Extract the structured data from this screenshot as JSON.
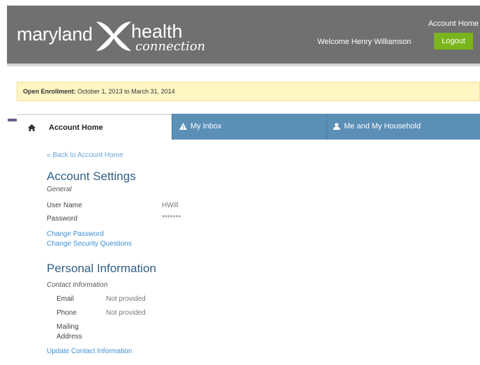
{
  "header": {
    "logo_maryland": "maryland",
    "logo_health": "health",
    "logo_connection": "connection",
    "account_home_link": "Account Home",
    "welcome_text": "Welcome Henry Williamson",
    "logout_label": "Logout",
    "header_bg": "#707070",
    "logout_color": "#7ab51d"
  },
  "notice": {
    "label": "Open Enrollment:",
    "text": "October 1, 2013 to March 31, 2014"
  },
  "tabs": [
    {
      "label": "Account Home",
      "icon": "home-icon",
      "active": true
    },
    {
      "label": "My Inbox",
      "icon": "warning-icon",
      "active": false
    },
    {
      "label": "Me and My Household",
      "icon": "person-icon",
      "active": false
    }
  ],
  "content": {
    "back_link": "Back to Account Home",
    "account_settings": {
      "title": "Account Settings",
      "subtitle": "General",
      "user_name_label": "User Name",
      "user_name_value": "HWill",
      "password_label": "Password",
      "password_value": "*******",
      "change_password_link": "Change Password",
      "change_security_link": "Change Security Questions"
    },
    "personal_info": {
      "title": "Personal Information",
      "subtitle": "Contact Information",
      "email_label": "Email",
      "email_value": "Not provided",
      "phone_label": "Phone",
      "phone_value": "Not provided",
      "mailing_label_1": "Mailing",
      "mailing_label_2": "Address",
      "update_link": "Update Contact Information"
    }
  }
}
